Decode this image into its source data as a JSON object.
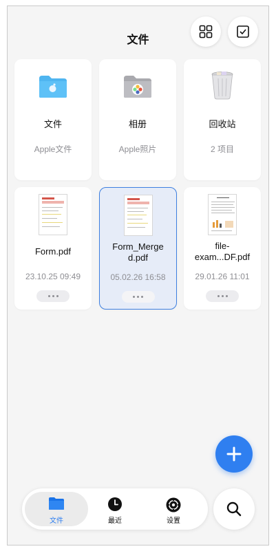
{
  "header": {
    "title": "文件",
    "grid_icon": "grid-view-icon",
    "select_icon": "checkbox-select-icon"
  },
  "locations": [
    {
      "name": "文件",
      "subtitle": "Apple文件",
      "icon": "blue-folder-icon"
    },
    {
      "name": "相册",
      "subtitle": "Apple照片",
      "icon": "photos-folder-icon"
    },
    {
      "name": "回收站",
      "subtitle": "2 项目",
      "icon": "trash-can-icon"
    }
  ],
  "files": [
    {
      "name": "Form.pdf",
      "date": "23.10.25 09:49",
      "selected": false
    },
    {
      "name": "Form_Merged.pdf",
      "name_line1": "Form_Merge",
      "name_line2": "d.pdf",
      "date": "05.02.26 16:58",
      "selected": true
    },
    {
      "name": "file-exam...DF.pdf",
      "name_line1": "file-",
      "name_line2": "exam...DF.pdf",
      "date": "29.01.26 11:01",
      "selected": false
    }
  ],
  "fab": {
    "icon": "plus-icon"
  },
  "tabbar": {
    "tabs": [
      {
        "label": "文件",
        "icon": "folder-icon",
        "active": true
      },
      {
        "label": "最近",
        "icon": "clock-icon",
        "active": false
      },
      {
        "label": "设置",
        "icon": "gear-icon",
        "active": false
      }
    ],
    "search_icon": "search-icon"
  },
  "colors": {
    "accent": "#2f7ff0",
    "selected_bg": "#e6ecf8",
    "secondary_text": "#8e8e93"
  }
}
